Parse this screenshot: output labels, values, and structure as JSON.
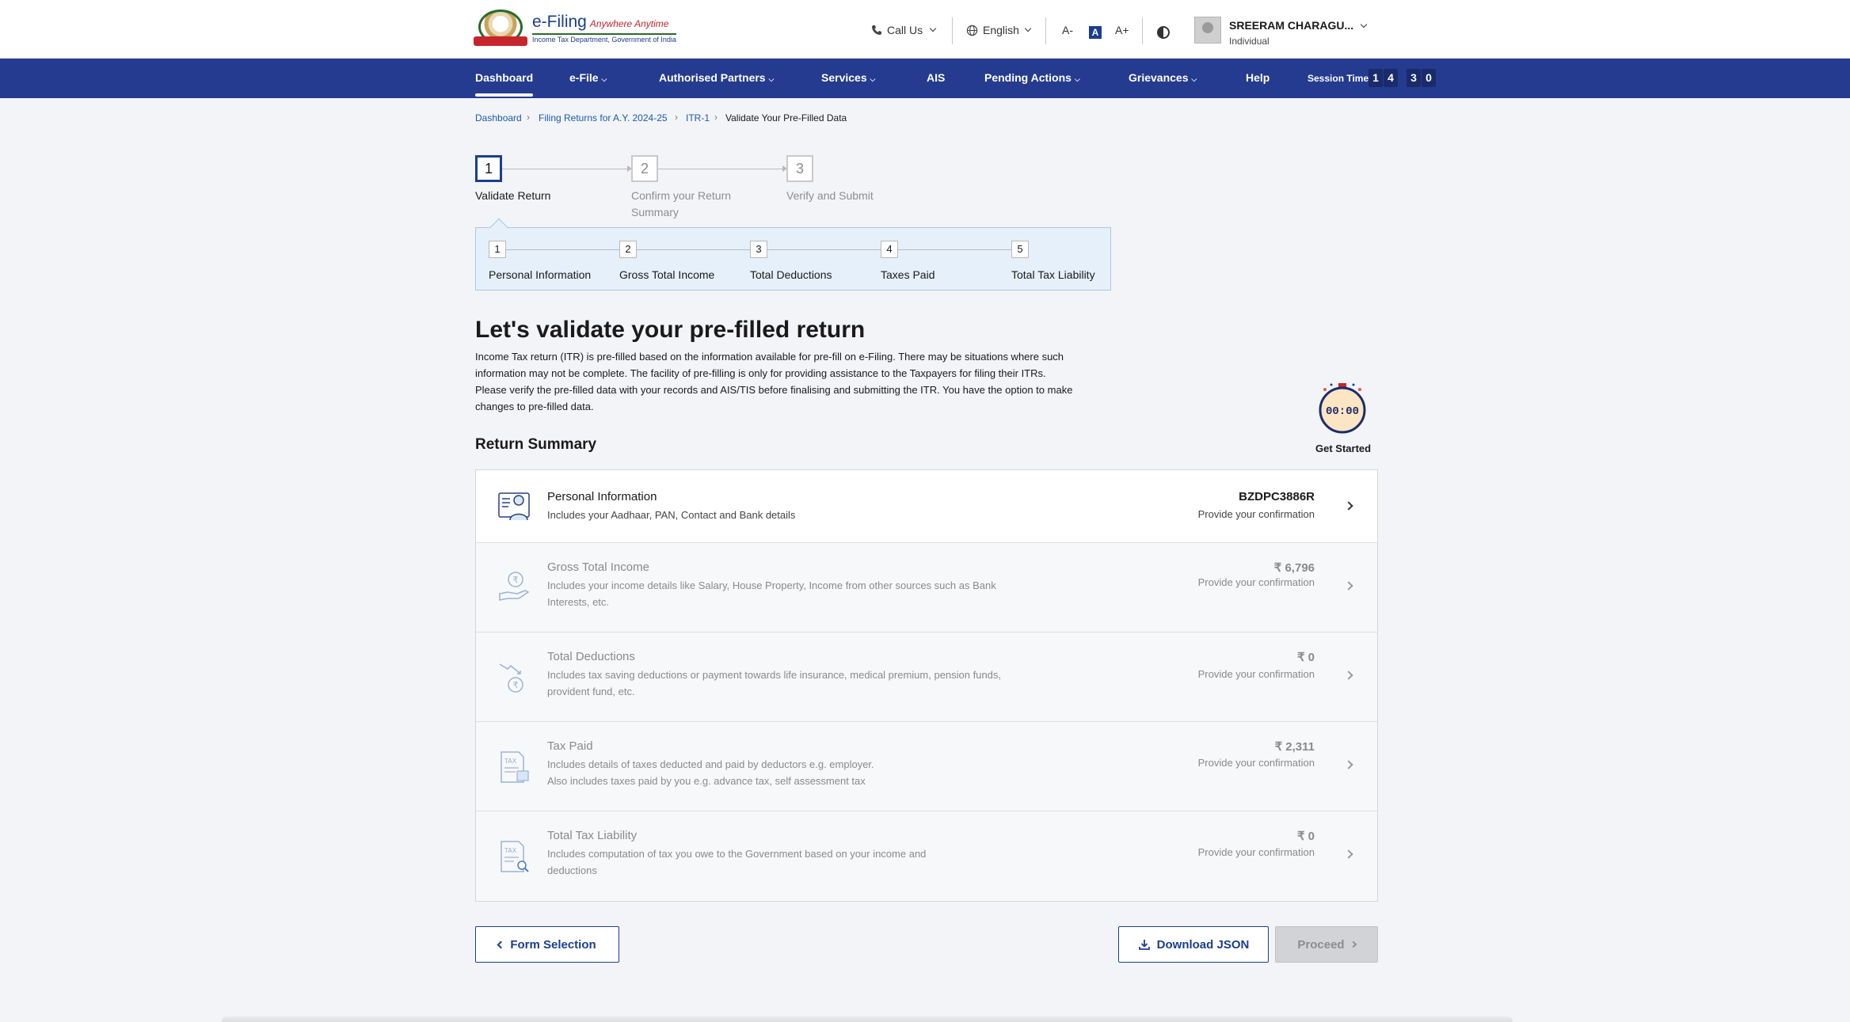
{
  "header": {
    "logo_title": "e-Filing",
    "logo_tagline": "Anywhere Anytime",
    "logo_subtitle": "Income Tax Department, Government of India",
    "call_us": "Call Us",
    "language": "English",
    "font_decrease": "A-",
    "font_normal": "A",
    "font_increase": "A+",
    "user_name": "SREERAM CHARAGU...",
    "user_role": "Individual"
  },
  "nav": {
    "items": [
      "Dashboard",
      "e-File",
      "Authorised Partners",
      "Services",
      "AIS",
      "Pending Actions",
      "Grievances",
      "Help"
    ],
    "active": "Dashboard",
    "session_label": "Session Time",
    "session_digits": [
      "1",
      "4",
      "3",
      "0"
    ]
  },
  "breadcrumb": [
    "Dashboard",
    "Filing Returns for A.Y. 2024-25",
    "ITR-1",
    "Validate Your Pre-Filled Data"
  ],
  "steps": [
    {
      "num": "1",
      "label": "Validate Return",
      "active": true
    },
    {
      "num": "2",
      "label": "Confirm your Return Summary",
      "active": false
    },
    {
      "num": "3",
      "label": "Verify and Submit",
      "active": false
    }
  ],
  "substeps": [
    {
      "num": "1",
      "label": "Personal Information"
    },
    {
      "num": "2",
      "label": "Gross Total Income"
    },
    {
      "num": "3",
      "label": "Total Deductions"
    },
    {
      "num": "4",
      "label": "Taxes Paid"
    },
    {
      "num": "5",
      "label": "Total Tax Liability"
    }
  ],
  "main": {
    "title": "Let's validate your pre-filled return",
    "intro": "Income Tax return (ITR) is pre-filled based on the information available for pre-fill on e-Filing. There may be situations where such information may not be complete. The facility of pre-filling is only for providing assistance to the Taxpayers for filing their ITRs. Please verify the pre-filled data with your records and AIS/TIS before finalising and submitting the ITR. You have the option to make changes to pre-filled data.",
    "section_title": "Return Summary",
    "timer_display": "00:00",
    "get_started": "Get Started"
  },
  "summary": [
    {
      "title": "Personal Information",
      "desc": "Includes your Aadhaar, PAN, Contact and Bank details",
      "value": "BZDPC3886R",
      "status": "Provide your confirmation",
      "icon": "personal-id-icon"
    },
    {
      "title": "Gross Total Income",
      "desc": "Includes your income details like Salary, House Property, Income from other sources such as Bank Interests, etc.",
      "value": "₹ 6,796",
      "status": "Provide your confirmation",
      "icon": "rupee-hand-icon"
    },
    {
      "title": "Total Deductions",
      "desc": "Includes tax saving deductions or payment towards life insurance, medical premium, pension funds, provident fund, etc.",
      "value": "₹ 0",
      "status": "Provide your confirmation",
      "icon": "deduction-icon"
    },
    {
      "title": "Tax Paid",
      "desc": "Includes details of taxes deducted and paid by deductors e.g. employer.\nAlso includes taxes paid by you e.g. advance tax, self assessment tax",
      "value": "₹ 2,311",
      "status": "Provide your confirmation",
      "icon": "tax-doc-icon"
    },
    {
      "title": "Total Tax Liability",
      "desc": "Includes computation of tax you owe to the Government based on your income and deductions",
      "value": "₹ 0",
      "status": "Provide your confirmation",
      "icon": "tax-search-icon"
    }
  ],
  "buttons": {
    "form_selection": "Form Selection",
    "download_json": "Download JSON",
    "proceed": "Proceed"
  },
  "colors": {
    "nav_bg": "#253b8f",
    "primary": "#1c3d8f",
    "substep_bg": "#e5f0fb",
    "page_bg": "#f3f4f8"
  }
}
